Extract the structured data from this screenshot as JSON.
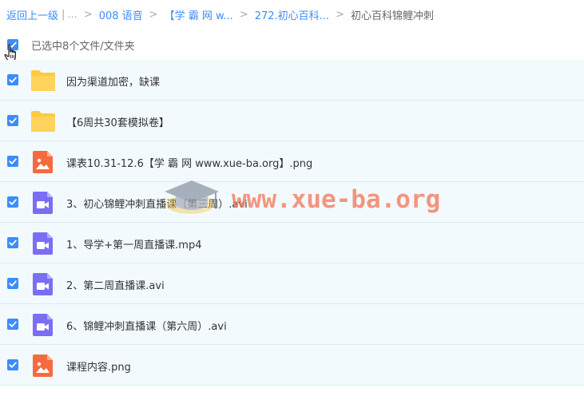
{
  "breadcrumb": {
    "back": "返回上一级",
    "ellipsis": "...",
    "items": [
      "008 语音",
      "【学 霸 网 w...",
      "272.初心百科..."
    ],
    "separator": ">",
    "current": "初心百科锦鲤冲刺"
  },
  "selection": {
    "label": "已选中8个文件/文件夹",
    "checked": true
  },
  "files": [
    {
      "name": "因为渠道加密，缺课",
      "type": "folder-icon"
    },
    {
      "name": "【6周共30套模拟卷】",
      "type": "folder-icon"
    },
    {
      "name": "课表10.31-12.6【学 霸 网 www.xue-ba.org】.png",
      "type": "image-file-icon"
    },
    {
      "name": "3、初心锦鲤冲刺直播课（第三周）.avi",
      "type": "video-file-icon"
    },
    {
      "name": "1、导学+第一周直播课.mp4",
      "type": "video-file-icon"
    },
    {
      "name": "2、第二周直播课.avi",
      "type": "video-file-icon"
    },
    {
      "name": "6、锦鲤冲刺直播课（第六周）.avi",
      "type": "video-file-icon"
    },
    {
      "name": "课程内容.png",
      "type": "image-file-icon"
    }
  ],
  "watermark": {
    "text": "www.xue-ba.org"
  },
  "colors": {
    "accent": "#3b8cff",
    "row_bg": "#f3fafe",
    "folder": "#ffce4b",
    "image_icon": "#f76a3d",
    "video_icon": "#7a6ef6"
  }
}
